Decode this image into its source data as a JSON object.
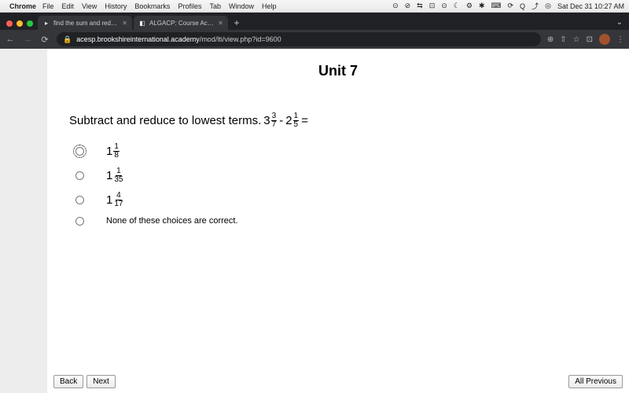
{
  "menubar": {
    "apple": "",
    "app_name": "Chrome",
    "items": [
      "File",
      "Edit",
      "View",
      "History",
      "Bookmarks",
      "Profiles",
      "Tab",
      "Window",
      "Help"
    ],
    "status_icons": [
      "⊙",
      "⊘",
      "⇆",
      "⊡",
      "⊙",
      "☾",
      "⚙",
      "✱",
      "⌨",
      "⟳",
      "Q",
      "⤴",
      "◎"
    ],
    "datetime": "Sat Dec 31 10:27 AM"
  },
  "tabs": [
    {
      "favicon": "▸",
      "title": "find the sum and reduce to low"
    },
    {
      "favicon": "◧",
      "title": "ALGACP: Course Access"
    }
  ],
  "url": {
    "domain": "acesp.brookshireinternational.academy",
    "path": "/mod/lti/view.php?id=9600"
  },
  "page": {
    "title": "Unit 7",
    "question_prefix": "Subtract and reduce to lowest terms. ",
    "term1": {
      "whole": "3",
      "num": "3",
      "den": "7"
    },
    "minus": " - ",
    "term2": {
      "whole": "2",
      "num": "1",
      "den": "5"
    },
    "equals": " =",
    "options": [
      {
        "type": "mixed",
        "whole": "1",
        "num": "1",
        "den": "8",
        "focused": true
      },
      {
        "type": "mixed",
        "whole": "1",
        "num": "1",
        "den": "35",
        "focused": false
      },
      {
        "type": "mixed",
        "whole": "1",
        "num": "4",
        "den": "17",
        "focused": false
      },
      {
        "type": "text",
        "text": "None of these choices are correct.",
        "focused": false
      }
    ],
    "buttons": {
      "back": "Back",
      "next": "Next",
      "all_previous": "All Previous"
    }
  }
}
